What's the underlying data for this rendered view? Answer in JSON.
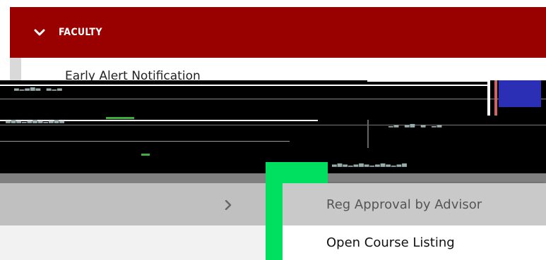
{
  "header": {
    "label": "FACULTY"
  },
  "menu": {
    "top_item": "Early Alert Notification"
  },
  "submenu": {
    "items": [
      {
        "label": "Reg Approval by Advisor"
      },
      {
        "label": "Open Course Listing"
      }
    ]
  },
  "colors": {
    "header_bg": "#990000",
    "highlight_bg": "#c9c9c9",
    "overlay_green": "#00e060"
  }
}
